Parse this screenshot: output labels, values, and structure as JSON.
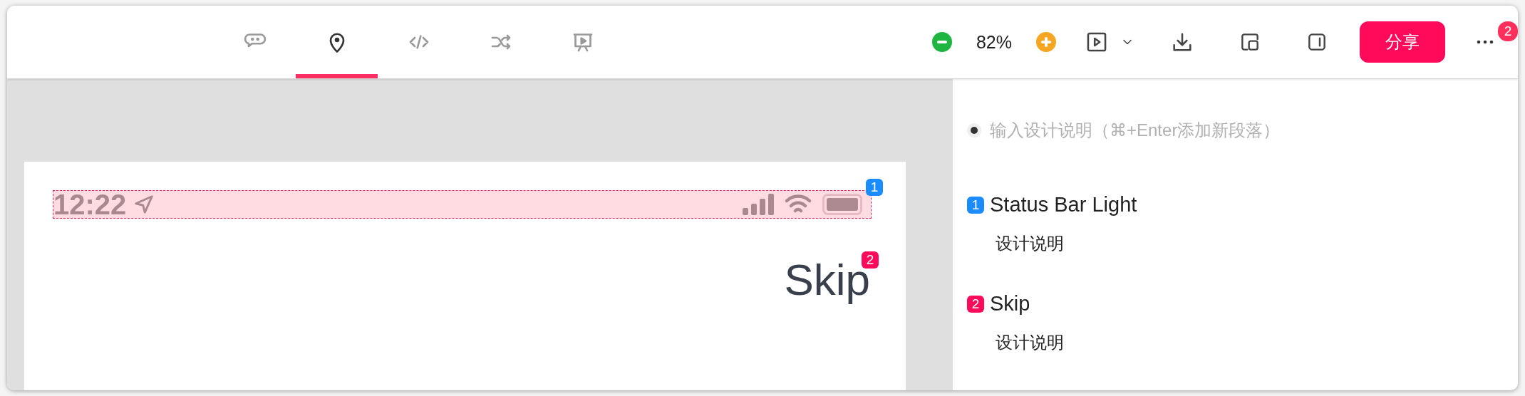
{
  "toolbar": {
    "tabs": [
      {
        "kind": "comment",
        "selected": false
      },
      {
        "kind": "pin",
        "selected": true
      },
      {
        "kind": "code",
        "selected": false
      },
      {
        "kind": "shuffle",
        "selected": false
      },
      {
        "kind": "present",
        "selected": false
      }
    ],
    "zoom": "82%",
    "share": "分享",
    "more_badge": "2"
  },
  "canvas": {
    "status_bar": {
      "time": "12:22",
      "marker": "1"
    },
    "skip": {
      "label": "Skip",
      "marker": "2"
    }
  },
  "notes": {
    "placeholder": "输入设计说明（⌘+Enter添加新段落）",
    "items": [
      {
        "marker": "1",
        "title": "Status Bar Light",
        "description": "设计说明",
        "color": "#1a8cff"
      },
      {
        "marker": "2",
        "title": "Skip",
        "description": "设计说明",
        "color": "#ff0a5a"
      }
    ]
  }
}
